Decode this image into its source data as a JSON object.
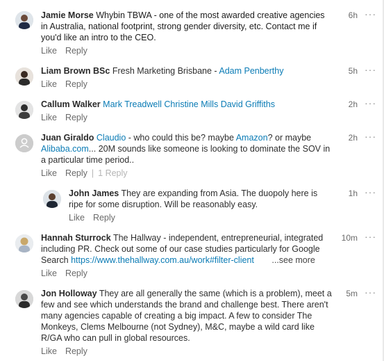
{
  "like_label": "Like",
  "reply_label": "Reply",
  "comments": [
    {
      "author": "Jamie Morse",
      "segments": [
        {
          "text": "Whybin TBWA - one of the most awarded creative agencies in Australia, national footprint, strong gender diversity, etc. Contact me if you'd like an intro to the CEO."
        }
      ],
      "time": "6h"
    },
    {
      "author": "Liam Brown BSc",
      "segments": [
        {
          "text": "Fresh Marketing Brisbane - "
        },
        {
          "mention": "Adam Penberthy"
        }
      ],
      "time": "5h"
    },
    {
      "author": "Callum Walker",
      "segments": [
        {
          "mention": "Mark Treadwell"
        },
        {
          "text": " "
        },
        {
          "mention": "Christine Mills"
        },
        {
          "text": " "
        },
        {
          "mention": "David Griffiths"
        }
      ],
      "time": "2h"
    },
    {
      "author": "Juan Giraldo",
      "segments": [
        {
          "mention": "Claudio"
        },
        {
          "text": " - who could this be? maybe "
        },
        {
          "mention": "Amazon"
        },
        {
          "text": "? or maybe "
        },
        {
          "mention": "Alibaba.com"
        },
        {
          "text": "... 20M sounds like someone is looking to dominate the SOV in a particular time period.."
        }
      ],
      "time": "2h",
      "reply_count": "1 Reply"
    },
    {
      "author": "John James",
      "segments": [
        {
          "text": "They are expanding from Asia. The duopoly here is ripe for some disruption. Will be reasonably easy."
        }
      ],
      "time": "1h"
    },
    {
      "author": "Hannah Sturrock",
      "segments": [
        {
          "text": "The Hallway - independent, entrepreneurial, integrated including PR. Check out some of our case studies particularly for Google Search "
        },
        {
          "link": "https://www.thehallway.com.au/work#filter-client"
        }
      ],
      "see_more": "...see more",
      "time": "10m"
    },
    {
      "author": "Jon Holloway",
      "segments": [
        {
          "text": "They are all generally the same (which is a problem), meet a few and see which understands the brand and challenge best. There aren't many agencies capable of creating a big impact. A few to consider The Monkeys, Clems Melbourne (not Sydney), M&C,  maybe a wild card like R/GA who can pull in global resources."
        }
      ],
      "time": "5m"
    }
  ]
}
